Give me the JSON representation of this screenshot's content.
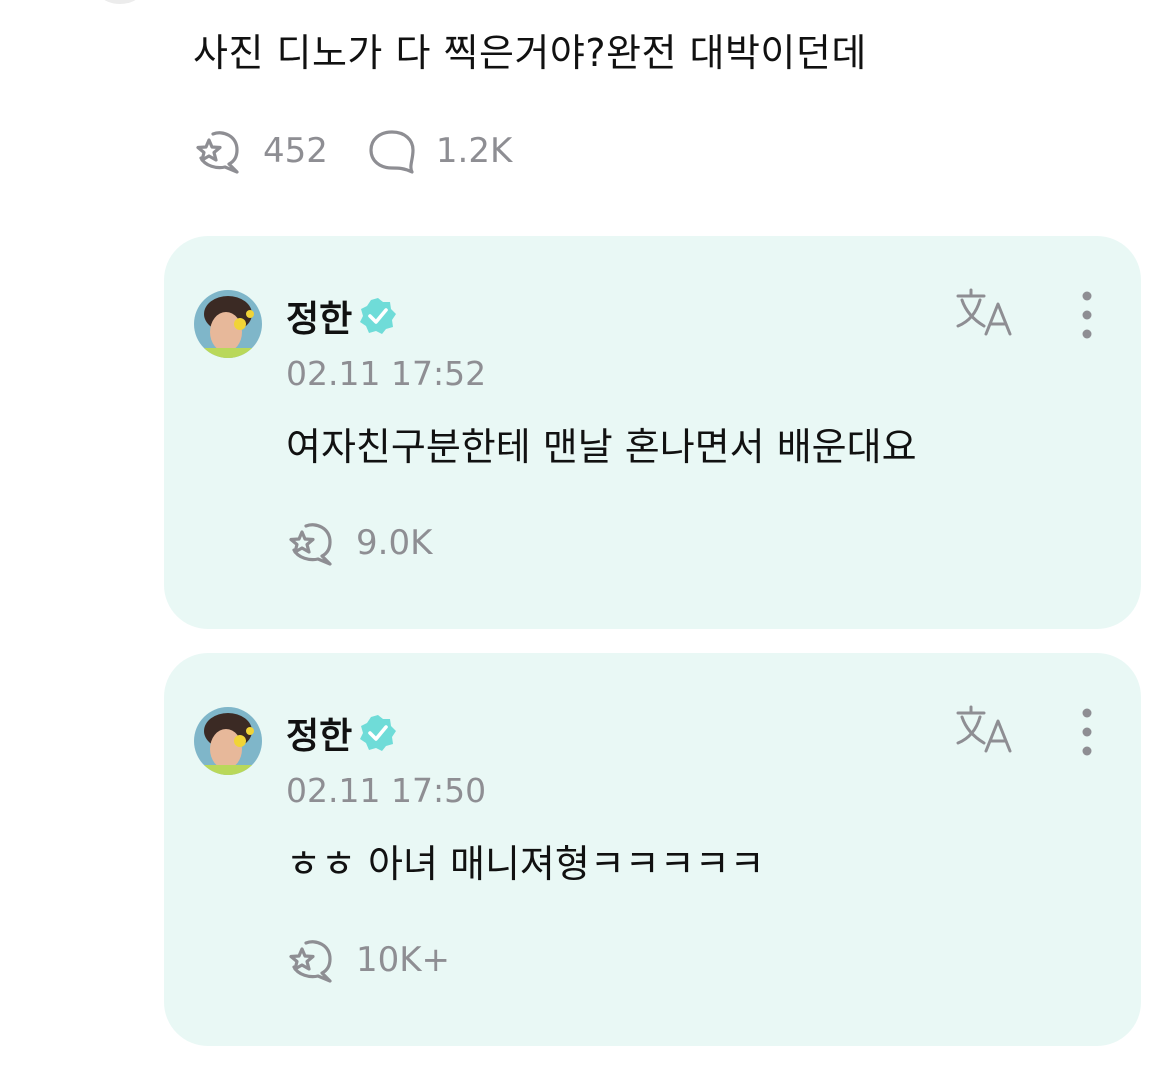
{
  "post": {
    "text": "사진 디노가 다 찍은거야?완전 대박이던데",
    "like_count": "452",
    "comment_count": "1.2K"
  },
  "replies": [
    {
      "author": "정한",
      "timestamp": "02.11 17:52",
      "text": "여자친구분한테 맨날 혼나면서 배운대요",
      "like_count": "9.0K"
    },
    {
      "author": "정한",
      "timestamp": "02.11 17:50",
      "text": "ㅎㅎ 아녀 매니져형ㅋㅋㅋㅋㅋ",
      "like_count": "10K+"
    }
  ],
  "icons": {
    "like": "star-bubble-icon",
    "comment": "speech-bubble-icon",
    "translate": "translate-icon",
    "more": "more-vertical-icon",
    "verified": "verified-badge-icon"
  },
  "colors": {
    "card_bg": "#e9f8f5",
    "verified": "#6fdcd8",
    "muted": "#8e8e93",
    "text": "#111111"
  }
}
